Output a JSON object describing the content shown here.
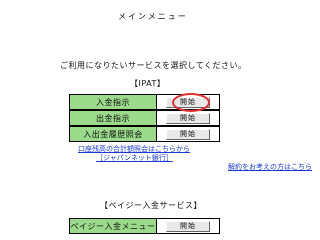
{
  "header": {
    "title": "メインメニュー"
  },
  "intro": "ご利用になりたいサービスを選択してください。",
  "ipat": {
    "heading": "【IPAT】",
    "rows": [
      {
        "label": "入金指示",
        "button": "開始"
      },
      {
        "label": "出金指示",
        "button": "開始"
      },
      {
        "label": "入出金履歴照会",
        "button": "開始"
      }
    ],
    "link1": "口座残高の合計額照会はこちらから",
    "link2": "［ジャパンネット銀行］",
    "link3": "解約をお考えの方はこちら"
  },
  "pay": {
    "heading": "【ペイジー入金サービス】",
    "rows": [
      {
        "label": "ペイジー入金メニュー",
        "button": "開始"
      }
    ]
  },
  "colors": {
    "label_bg": "#9bd98b",
    "link": "#1a3bd1",
    "highlight": "#e03030"
  }
}
